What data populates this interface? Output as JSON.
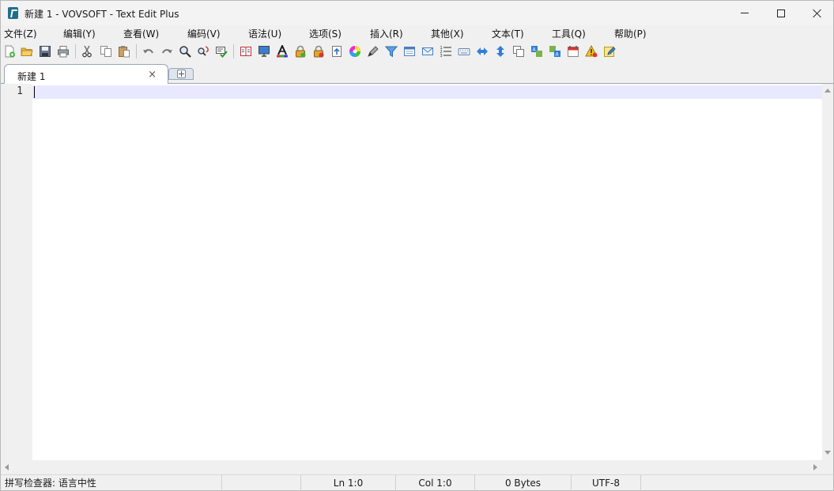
{
  "window": {
    "title": "新建 1 - VOVSOFT - Text Edit Plus"
  },
  "menu": [
    "文件(Z)",
    "编辑(Y)",
    "查看(W)",
    "编码(V)",
    "语法(U)",
    "选项(S)",
    "插入(R)",
    "其他(X)",
    "文本(T)",
    "工具(Q)",
    "帮助(P)"
  ],
  "toolbar": {
    "icons": [
      "new-file-icon",
      "open-folder-icon",
      "save-icon",
      "print-icon",
      "cut-icon",
      "copy-icon",
      "paste-icon",
      "undo-icon",
      "redo-icon",
      "find-icon",
      "replace-icon",
      "spellcheck-icon",
      "book-icon",
      "monitor-icon",
      "font-color-icon",
      "lock-icon",
      "unlock-icon",
      "upload-icon",
      "color-wheel-icon",
      "pen-icon",
      "filter-icon",
      "window-icon",
      "mail-icon",
      "list-icon",
      "keyboard-icon",
      "arrow-right-icon",
      "arrow-down-icon",
      "duplicate-icon",
      "translate-icon",
      "translate-alt-icon",
      "calendar-icon",
      "warning-icon",
      "edit-note-icon"
    ]
  },
  "tabs": [
    {
      "label": "新建 1",
      "close": "×"
    }
  ],
  "editor": {
    "line_numbers": [
      "1"
    ],
    "content": ""
  },
  "status": {
    "spellcheck": "拼写检查器: 语言中性",
    "line": "Ln 1:0",
    "col": "Col 1:0",
    "size": "0 Bytes",
    "encoding": "UTF-8"
  },
  "colors": {
    "current_line": "#e8e8ff",
    "tab_border": "#9aa7b8",
    "app_icon": "#1f6f8b"
  }
}
